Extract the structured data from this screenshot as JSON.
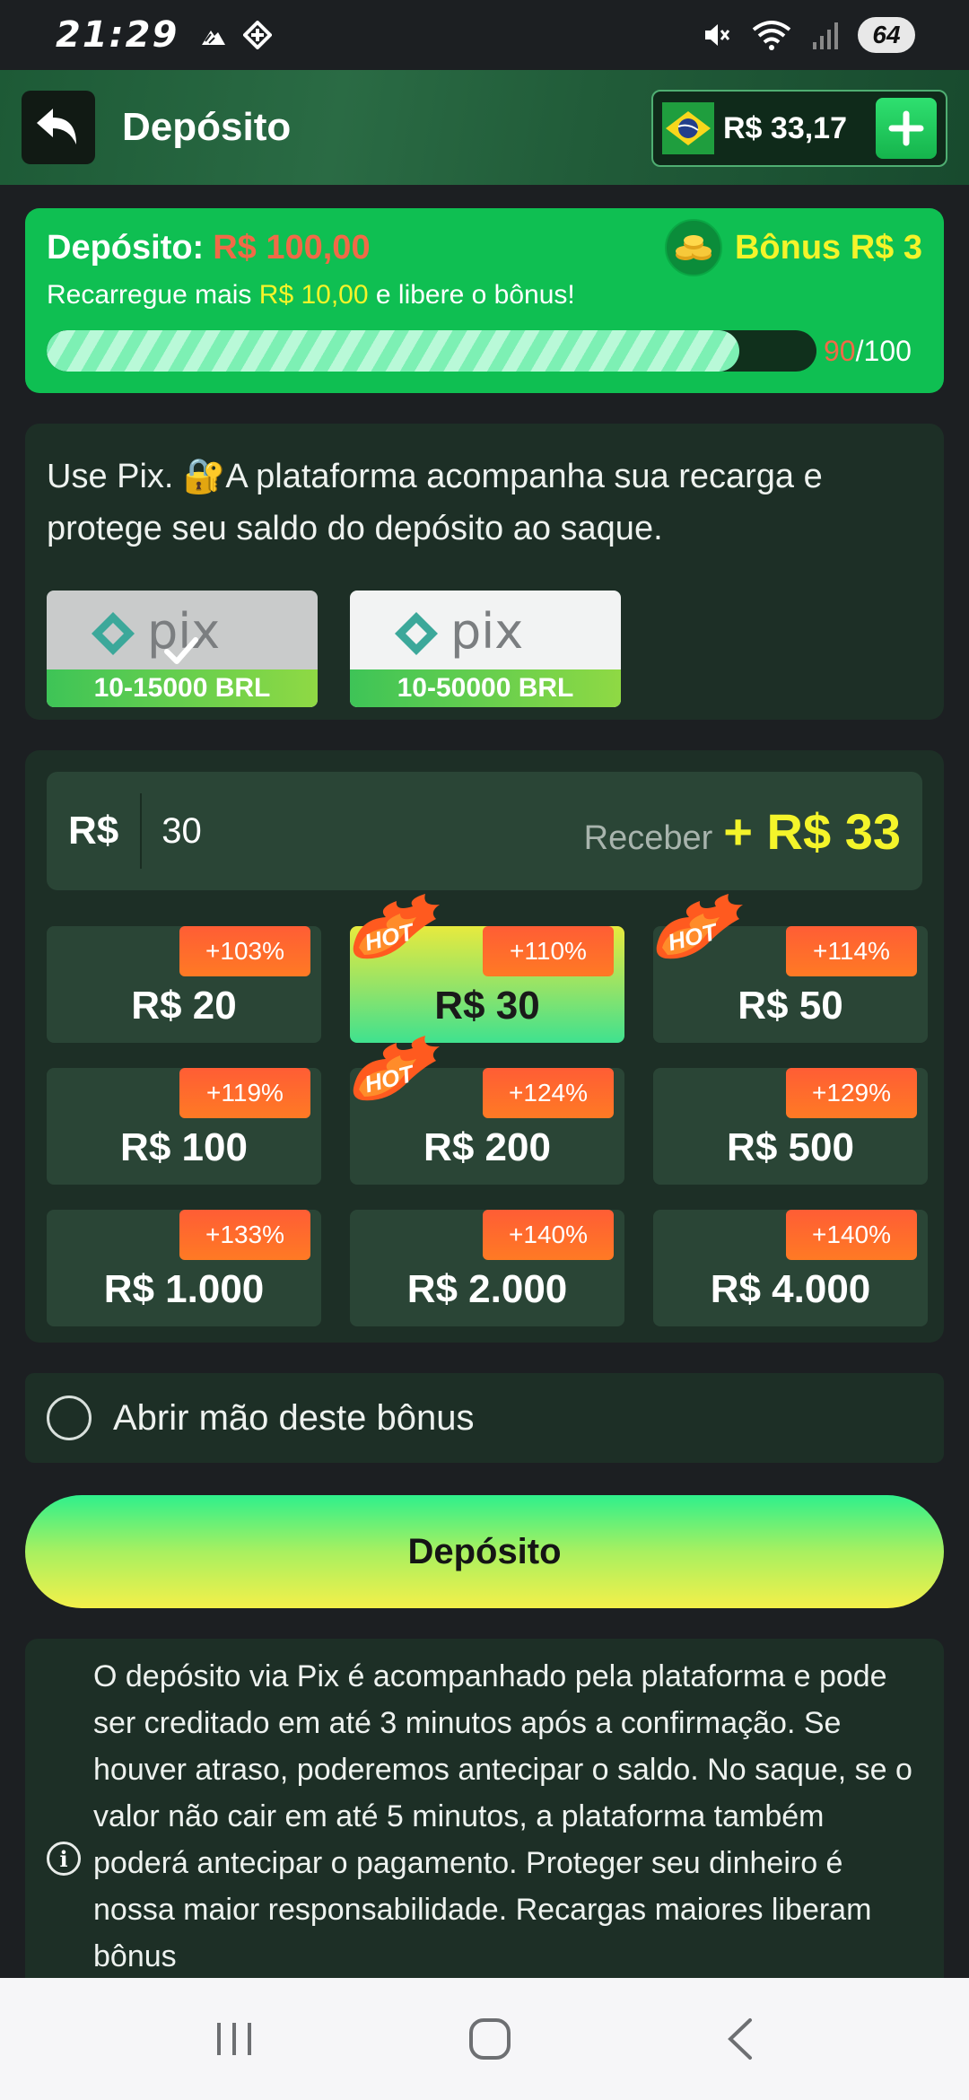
{
  "status_bar": {
    "time": "21:29",
    "battery": "64"
  },
  "header": {
    "title": "Depósito",
    "balance": "R$ 33,17"
  },
  "bonus_card": {
    "deposit_label": "Depósito:",
    "deposit_amount": "R$ 100,00",
    "bonus_label": "Bônus R$ 3",
    "recharge_prefix": "Recarregue mais",
    "recharge_amount": "R$ 10,00",
    "recharge_suffix": "e libere o bônus!",
    "progress_current": "90",
    "progress_total": "/100",
    "progress_fraction": 0.9
  },
  "pix_card": {
    "text": "Use Pix. 🔐A plataforma acompanha sua recarga e protege seu saldo do depósito ao saque.",
    "options": [
      {
        "logo_text": "pix",
        "range": "10-15000 BRL",
        "selected": true
      },
      {
        "logo_text": "pix",
        "range": "10-50000 BRL",
        "selected": false
      }
    ]
  },
  "amount_panel": {
    "currency": "R$",
    "input_value": "30",
    "receive_label": "Receber",
    "receive_value": "+ R$ 33",
    "hot_label": "HOT",
    "amounts": [
      {
        "value": "R$ 20",
        "pct": "+103%",
        "hot": false,
        "selected": false
      },
      {
        "value": "R$ 30",
        "pct": "+110%",
        "hot": true,
        "selected": true
      },
      {
        "value": "R$ 50",
        "pct": "+114%",
        "hot": true,
        "selected": false
      },
      {
        "value": "R$ 100",
        "pct": "+119%",
        "hot": false,
        "selected": false
      },
      {
        "value": "R$ 200",
        "pct": "+124%",
        "hot": true,
        "selected": false
      },
      {
        "value": "R$ 500",
        "pct": "+129%",
        "hot": false,
        "selected": false
      },
      {
        "value": "R$ 1.000",
        "pct": "+133%",
        "hot": false,
        "selected": false
      },
      {
        "value": "R$ 2.000",
        "pct": "+140%",
        "hot": false,
        "selected": false
      },
      {
        "value": "R$ 4.000",
        "pct": "+140%",
        "hot": false,
        "selected": false
      }
    ]
  },
  "forgo_bonus_label": "Abrir mão deste bônus",
  "deposit_button_label": "Depósito",
  "info_text": "O depósito via Pix é acompanhado pela plataforma e pode ser creditado em até 3 minutos após a confirmação. Se houver atraso, poderemos antecipar o saldo. No saque, se o valor não cair em até 5 minutos, a plataforma também poderá antecipar o pagamento. Proteger seu dinheiro é nossa maior responsabilidade. Recargas maiores liberam bônus",
  "colors": {
    "accent_green": "#0fbf52",
    "highlight_yellow": "#f4f42a",
    "deposit_red": "#f06a47",
    "badge_orange": "#ff6a2c"
  }
}
